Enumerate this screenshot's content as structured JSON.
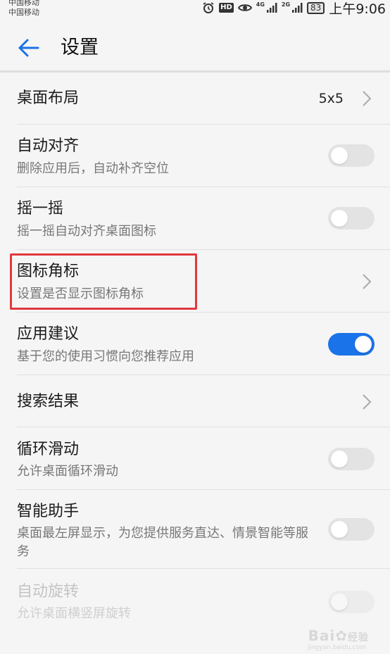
{
  "status_bar": {
    "carrier1": "中国移动",
    "carrier2": "中国移动",
    "hd": "HD",
    "net1": "4G",
    "net2": "2G",
    "battery": "83",
    "time": "上午9:06"
  },
  "header": {
    "back_icon": "arrow-left-icon",
    "title": "设置"
  },
  "settings": [
    {
      "title": "桌面布局",
      "value": "5x5",
      "control": "chevron"
    },
    {
      "title": "自动对齐",
      "subtitle": "删除应用后，自动补齐空位",
      "control": "toggle",
      "on": false
    },
    {
      "title": "摇一摇",
      "subtitle": "摇一摇自动对齐桌面图标",
      "control": "toggle",
      "on": false
    },
    {
      "title": "图标角标",
      "subtitle": "设置是否显示图标角标",
      "control": "chevron",
      "highlighted": true
    },
    {
      "title": "应用建议",
      "subtitle": "基于您的使用习惯向您推荐应用",
      "control": "toggle",
      "on": true
    },
    {
      "title": "搜索结果",
      "control": "chevron"
    },
    {
      "title": "循环滑动",
      "subtitle": "允许桌面循环滑动",
      "control": "toggle",
      "on": false
    },
    {
      "title": "智能助手",
      "subtitle": "桌面最左屏显示，为您提供服务直达、情景智能等服务",
      "control": "toggle",
      "on": false
    },
    {
      "title": "自动旋转",
      "subtitle": "允许桌面横竖屏旋转",
      "control": "toggle",
      "on": false,
      "disabled": true
    }
  ],
  "colors": {
    "accent": "#1a73e8",
    "highlight_box": "#e0393e",
    "background": "#f5f5f5"
  },
  "watermark": {
    "text": "Bai",
    "suffix": "经验",
    "url": "jingyan.baidu.com"
  }
}
